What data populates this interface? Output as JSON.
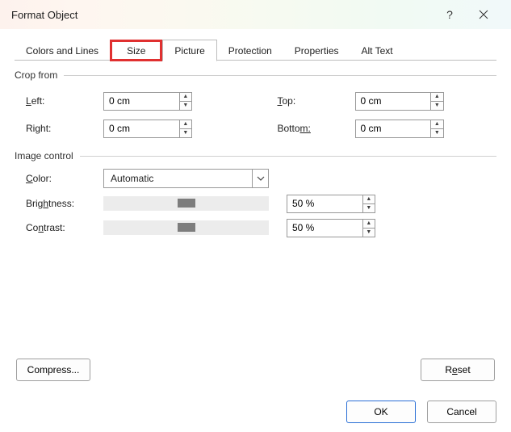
{
  "titlebar": {
    "title": "Format Object"
  },
  "tabs": {
    "colors": "Colors and Lines",
    "size": "Size",
    "picture": "Picture",
    "protection": "Protection",
    "properties": "Properties",
    "alt": "Alt Text"
  },
  "groups": {
    "crop_from": "Crop from",
    "image_control": "Image control"
  },
  "crop": {
    "left_label_pre": "L",
    "left_label_post": "eft:",
    "right_labelA": "Ri",
    "right_labelB": "g",
    "right_labelC": "ht:",
    "top_label_pre": "T",
    "top_label_post": "op:",
    "bottom_label_pre": "Botto",
    "bottom_label_post": "m:",
    "left_value": "0 cm",
    "right_value": "0 cm",
    "top_value": "0 cm",
    "bottom_value": "0 cm"
  },
  "image": {
    "color_label_pre": "C",
    "color_label_post": "olor:",
    "color_value": "Automatic",
    "brightness_labelA": "Brig",
    "brightness_labelB": "h",
    "brightness_labelC": "tness:",
    "contrast_labelA": "Co",
    "contrast_labelB": "n",
    "contrast_labelC": "trast:",
    "brightness_value": "50 %",
    "contrast_value": "50 %"
  },
  "buttons": {
    "compress": "Compress...",
    "reset_pre": "R",
    "reset_u": "e",
    "reset_post": "set",
    "ok": "OK",
    "cancel": "Cancel"
  }
}
